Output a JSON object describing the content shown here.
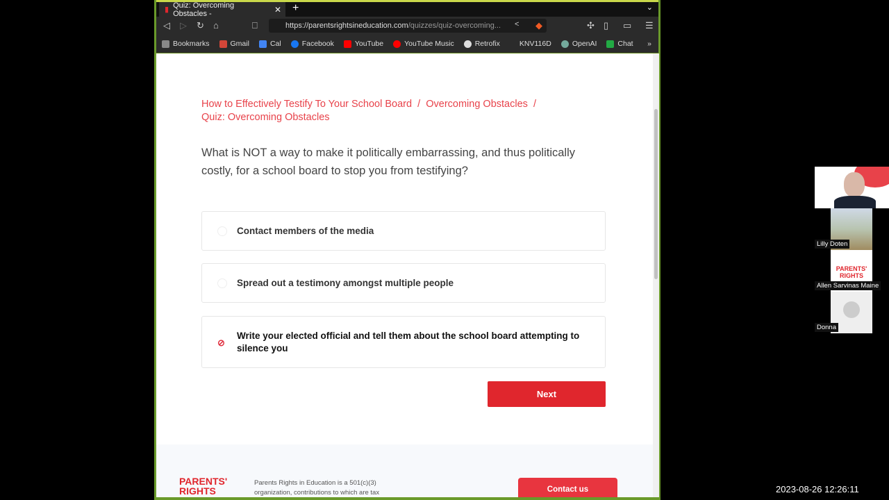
{
  "browser": {
    "tab_title": "Quiz: Overcoming Obstacles -",
    "url_host": "https://parentsrightsineducation.com",
    "url_path": "/quizzes/quiz-overcoming...",
    "bookmarks": [
      {
        "label": "Bookmarks",
        "icon": "folder-icon",
        "color": "#888888"
      },
      {
        "label": "Gmail",
        "icon": "gmail-icon",
        "color": "#d44638"
      },
      {
        "label": "Cal",
        "icon": "calendar-icon",
        "color": "#4285f4"
      },
      {
        "label": "Facebook",
        "icon": "facebook-icon",
        "color": "#1877f2"
      },
      {
        "label": "YouTube",
        "icon": "youtube-icon",
        "color": "#ff0000"
      },
      {
        "label": "YouTube Music",
        "icon": "youtube-music-icon",
        "color": "#ff0000"
      },
      {
        "label": "Retrofix",
        "icon": "globe-icon",
        "color": "#dddddd"
      },
      {
        "label": "KNV116D",
        "icon": "",
        "color": ""
      },
      {
        "label": "OpenAI",
        "icon": "openai-icon",
        "color": "#74aa9c"
      },
      {
        "label": "Chat",
        "icon": "chat-icon",
        "color": "#22aa44"
      }
    ]
  },
  "page": {
    "breadcrumb": [
      "How to Effectively Testify To Your School Board",
      "Overcoming Obstacles",
      "Quiz: Overcoming Obstacles"
    ],
    "separator": "/",
    "question": "What is NOT a way to make it politically embarrassing, and thus politically costly, for a school board to stop you from testifying?",
    "options": [
      {
        "label": "Contact members of the media",
        "selected": false
      },
      {
        "label": "Spread out a testimony amongst multiple people",
        "selected": false
      },
      {
        "label": "Write your elected official and tell them about the school board attempting to silence you",
        "selected": true
      }
    ],
    "next_label": "Next",
    "footer": {
      "logo": "PARENTS' RIGHTS",
      "text": "Parents Rights in Education is a 501(c)(3) organization, contributions to which are tax",
      "contact_label": "Contact us"
    }
  },
  "video": {
    "participants": [
      "Lilly Doten",
      "Allen Sarvinas Maine",
      "Donna"
    ]
  },
  "timestamp": "2023-08-26 12:26:11",
  "colors": {
    "accent": "#e0262d",
    "link": "#e8424a"
  }
}
